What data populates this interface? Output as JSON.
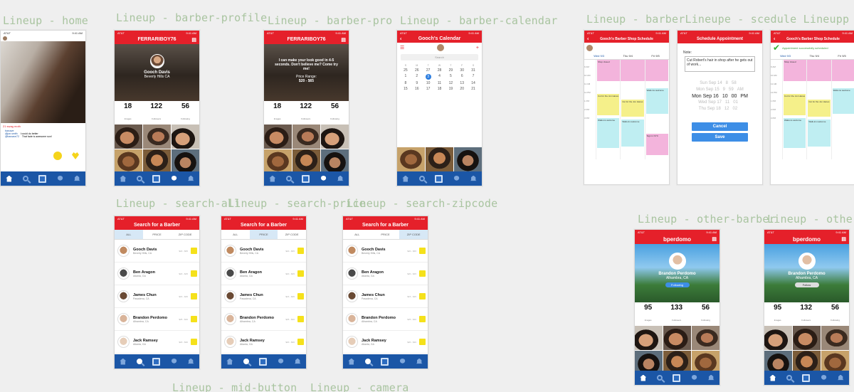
{
  "boards": {
    "home": "Lineup - home",
    "barber_profile": "Lineup - barber-profile",
    "barber_pro": "Lineup - barber-pro",
    "barber_calendar": "Lineup - barber-calendar",
    "barber_schedule": "Lineup - barberLineupe - scedule Lineupp - ssc",
    "search_all": "Lineup - search-all",
    "search_price": "Lineup - search-price",
    "search_zipcode": "Lineup - search-zipcode",
    "other_barber": "Lineup - other-barber",
    "other": "Lineup - other",
    "mid_button": "Lineup - mid-button",
    "camera": "Lineup - camera"
  },
  "status": {
    "carrier": "AT&T",
    "time": "9:41 AM"
  },
  "home": {
    "likes": "21 swag moth",
    "comment_user_1": "barcave",
    "comment_user_2": "@jon.smith",
    "comment_1": "I could do better",
    "comment_user_3": "@barcave72",
    "comment_2": "That fade is awesome son!"
  },
  "profile": {
    "username": "FERRARIBOY76",
    "name": "Gooch Davis",
    "location": "Beverly Hills CA",
    "bio": "I can make your look good in 4-5 seconds. Don't believe me? Come try me!",
    "price_label": "Price Range:",
    "price": "$20 - $65",
    "stats": [
      {
        "value": "18",
        "label": "Images"
      },
      {
        "value": "122",
        "label": "Followers"
      },
      {
        "value": "56",
        "label": "Following"
      }
    ]
  },
  "calendar": {
    "title": "Gooch's Calendar",
    "search_placeholder": "Search",
    "weekdays": [
      "S",
      "M",
      "T",
      "W",
      "T",
      "F",
      "S"
    ],
    "rows": [
      [
        "25",
        "26",
        "27",
        "28",
        "29",
        "30",
        "31"
      ],
      [
        "1",
        "2",
        "3",
        "4",
        "5",
        "6",
        "7"
      ],
      [
        "8",
        "9",
        "10",
        "11",
        "12",
        "13",
        "14"
      ],
      [
        "15",
        "16",
        "17",
        "18",
        "19",
        "20",
        "21"
      ]
    ],
    "selected": "3"
  },
  "schedule": {
    "title": "Gooch's Barber Shop Schedule",
    "days": [
      "Wed 9/3",
      "Thu 9/4",
      "Fri 9/5"
    ],
    "times": [
      "9 AM",
      "10 AM",
      "11 AM",
      "12 PM",
      "1 PM",
      "2 PM",
      "3 PM"
    ],
    "event_shop": "Shop closed",
    "event_cut": "Cut for the Jon Hanes",
    "event_walkin": "Walk-ins welcome",
    "event_sign": "Sign in NYC"
  },
  "appointment": {
    "title": "Schedule Appointment",
    "note_label": "Note:",
    "note": "Cut Robert's hair in shop after he gets out of work...",
    "picker_rows": [
      [
        "Sun Sep 14",
        "8",
        "58",
        ""
      ],
      [
        "Mon Sep 15",
        "9",
        "59",
        "AM"
      ],
      [
        "Mon Sep 16",
        "10",
        "00",
        "PM"
      ],
      [
        "Wed Sep 17",
        "11",
        "01",
        ""
      ],
      [
        "Thu Sep 18",
        "12",
        "02",
        ""
      ]
    ],
    "cancel": "Cancel",
    "save": "Save",
    "success": "Appointment successfully scheduled"
  },
  "search": {
    "title": "Search for a Barber",
    "tabs": [
      "ALL",
      "PRICE",
      "ZIP CODE"
    ],
    "results": [
      {
        "name": "Gooch Davis",
        "loc": "Beverly Hills, CA",
        "meta": "$20 - $65"
      },
      {
        "name": "Ben Aragon",
        "loc": "Atlanta, GA",
        "meta": "$20 - $45"
      },
      {
        "name": "James Chun",
        "loc": "Pasadena, CA",
        "meta": "$15 - $35"
      },
      {
        "name": "Brandon Perdomo",
        "loc": "Alhambra, CA",
        "meta": "$25 - $40"
      },
      {
        "name": "Jack Ramsey",
        "loc": "Atlanta, GA",
        "meta": "$20 - $30"
      }
    ]
  },
  "other": {
    "username": "bperdomo",
    "name": "Brandon Perdomo",
    "location": "Alhambra, CA",
    "follow_on": "Following",
    "follow_off": "Follow",
    "stats": [
      {
        "value": "95",
        "label": "Images"
      },
      {
        "value": "133",
        "label": "Followers"
      },
      {
        "value": "56",
        "label": "Following"
      }
    ],
    "stats_b": [
      {
        "value": "95",
        "label": "Images"
      },
      {
        "value": "132",
        "label": "Followers"
      },
      {
        "value": "56",
        "label": "Following"
      }
    ]
  }
}
